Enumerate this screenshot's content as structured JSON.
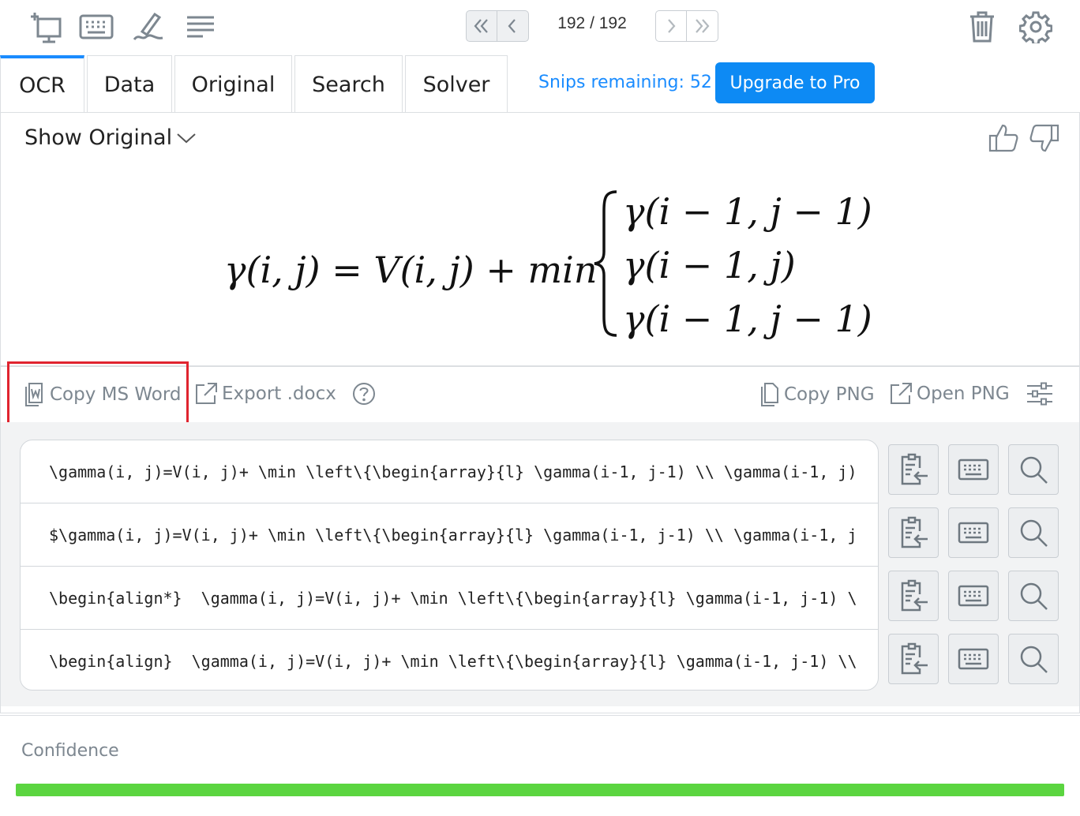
{
  "toolbar": {
    "icons": [
      "new-snip-icon",
      "keyboard-icon",
      "draw-icon",
      "menu-icon",
      "trash-icon",
      "gear-icon"
    ],
    "page_counter": "192 / 192"
  },
  "tabs": [
    {
      "label": "OCR",
      "active": true
    },
    {
      "label": "Data",
      "active": false
    },
    {
      "label": "Original",
      "active": false
    },
    {
      "label": "Search",
      "active": false
    },
    {
      "label": "Solver",
      "active": false
    }
  ],
  "snips_remaining": "Snips remaining: 52",
  "upgrade_label": "Upgrade to Pro",
  "show_original_label": "Show Original",
  "equation": {
    "lhs": "γ(i, j) = V(i, j) + min",
    "cases": [
      "γ(i − 1, j − 1)",
      "γ(i − 1, j)",
      "γ(i − 1, j − 1)"
    ]
  },
  "actions": {
    "copy_ms_word": "Copy MS Word",
    "export_docx": "Export .docx",
    "copy_png": "Copy PNG",
    "open_png": "Open PNG"
  },
  "code_rows": [
    "\\gamma(i, j)=V(i, j)+ \\min \\left\\{\\begin{array}{l} \\gamma(i-1, j-1) \\\\ \\gamma(i-1, j)",
    "$\\gamma(i, j)=V(i, j)+ \\min \\left\\{\\begin{array}{l} \\gamma(i-1, j-1) \\\\ \\gamma(i-1, j",
    "\\begin{align*}  \\gamma(i, j)=V(i, j)+ \\min \\left\\{\\begin{array}{l} \\gamma(i-1, j-1) \\",
    "\\begin{align}  \\gamma(i, j)=V(i, j)+ \\min \\left\\{\\begin{array}{l} \\gamma(i-1, j-1) \\\\"
  ],
  "confidence": {
    "label": "Confidence",
    "value": 1.0,
    "color": "#5bd540"
  },
  "colors": {
    "accent": "#0d8af4",
    "highlight": "#e0242f"
  }
}
